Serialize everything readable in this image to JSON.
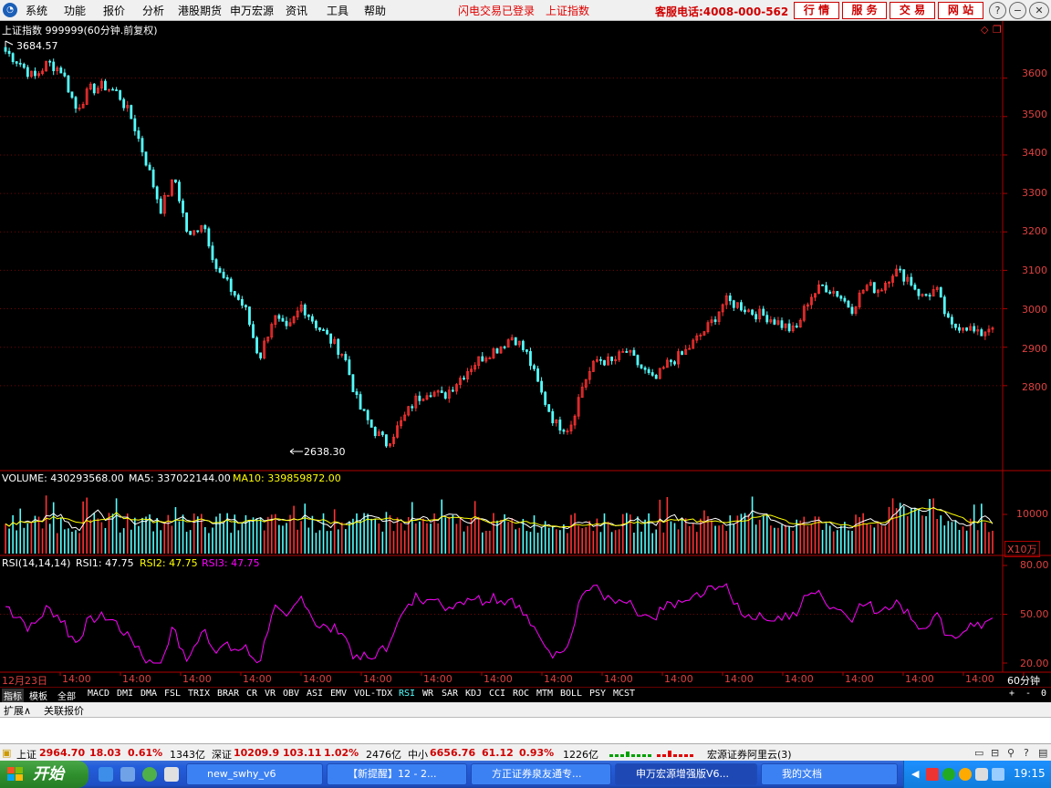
{
  "menu": {
    "items": [
      "系统",
      "功能",
      "报价",
      "分析",
      "港股期货",
      "申万宏源",
      "资讯",
      "工具",
      "帮助"
    ],
    "flash_login": "闪电交易已登录",
    "index_name": "上证指数",
    "service_phone": "客服电话:4008-000-562",
    "buttons": [
      "行 情",
      "服 务",
      "交 易",
      "网 站"
    ]
  },
  "chart_header": {
    "title": "上证指数 999999(60分钟.前复权)",
    "high_marker": "3684.57",
    "low_marker": "2638.30"
  },
  "price_axis": [
    "3600",
    "3500",
    "3400",
    "3300",
    "3200",
    "3100",
    "3000",
    "2900",
    "2800"
  ],
  "volume_header": {
    "label": "VOLUME: 430293568.00",
    "ma5": "MA5: 337022144.00",
    "ma10": "MA10: 339859872.00"
  },
  "volume_axis": {
    "tick": "10000",
    "unit": "X10万"
  },
  "rsi_header": {
    "label": "RSI(14,14,14)",
    "rsi1": "RSI1: 47.75",
    "rsi2": "RSI2: 47.75",
    "rsi3": "RSI3: 47.75"
  },
  "rsi_axis": [
    "80.00",
    "50.00",
    "20.00"
  ],
  "time_axis": {
    "first": "12月23日",
    "labels": [
      "14:00",
      "14:00",
      "14:00",
      "14:00",
      "14:00",
      "14:00",
      "14:00",
      "14:00",
      "14:00",
      "14:00",
      "14:00",
      "14:00",
      "14:00",
      "14:00",
      "14:00",
      "14:00",
      "14:00"
    ],
    "period": "60分钟"
  },
  "indicator_tabs": [
    "指标",
    "模板",
    "全部",
    "MACD",
    "DMI",
    "DMA",
    "FSL",
    "TRIX",
    "BRAR",
    "CR",
    "VR",
    "OBV",
    "ASI",
    "EMV",
    "VOL-TDX",
    "RSI",
    "WR",
    "SAR",
    "KDJ",
    "CCI",
    "ROC",
    "MTM",
    "BOLL",
    "PSY",
    "MCST"
  ],
  "zoom_buttons": [
    "+",
    "-",
    "0"
  ],
  "ext_tabs": [
    "扩展∧",
    "关联报价"
  ],
  "status": {
    "sh_label": "上证",
    "sh_value": "2964.70",
    "sh_change": "18.03",
    "sh_pct": "0.61%",
    "sh_amount": "1343亿",
    "sz_label": "深证",
    "sz_value": "10209.9",
    "sz_change": "103.11",
    "sz_pct": "1.02%",
    "sz_amount": "2476亿",
    "zx_label": "中小",
    "zx_value": "6656.76",
    "zx_change": "61.12",
    "zx_pct": "0.93%",
    "zx_amount": "1226亿",
    "broker": "宏源证券阿里云(3)"
  },
  "taskbar": {
    "start": "开始",
    "tasks": [
      "new_swhy_v6",
      "【新提醒】12 - 2...",
      "方正证券泉友通专...",
      "申万宏源增强版V6...",
      "我的文档"
    ],
    "clock": "19:15"
  },
  "colors": {
    "up": "#ff3232",
    "down": "#54ffff",
    "axis": "#b00000",
    "ma5": "#ffffff",
    "ma10": "#ffff00",
    "rsi": "#ff00ff"
  },
  "chart_data": {
    "type": "candlestick",
    "title": "上证指数 999999(60分钟.前复权)",
    "price_ylim": [
      2638.3,
      3684.57
    ],
    "price_high": 3684.57,
    "price_low": 2638.3,
    "volume_last": 430293568.0,
    "volume_ma5": 337022144.0,
    "volume_ma10": 339859872.0,
    "rsi_last": 47.75,
    "rsi_ylim": [
      20,
      80
    ],
    "price_path": [
      3670,
      3640,
      3600,
      3640,
      3620,
      3520,
      3570,
      3580,
      3560,
      3490,
      3380,
      3260,
      3340,
      3180,
      3230,
      3100,
      3050,
      3000,
      2870,
      2980,
      2940,
      3010,
      2960,
      2920,
      2880,
      2750,
      2690,
      2650,
      2700,
      2760,
      2790,
      2770,
      2810,
      2850,
      2880,
      2900,
      2930,
      2880,
      2780,
      2700,
      2690,
      2810,
      2870,
      2860,
      2890,
      2850,
      2810,
      2860,
      2880,
      2920,
      2960,
      3020,
      3010,
      2990,
      2980,
      2960,
      2940,
      3030,
      3060,
      3040,
      3000,
      3060,
      3050,
      3100,
      3080,
      3030,
      3050,
      2950,
      2960,
      2930,
      2960
    ]
  }
}
